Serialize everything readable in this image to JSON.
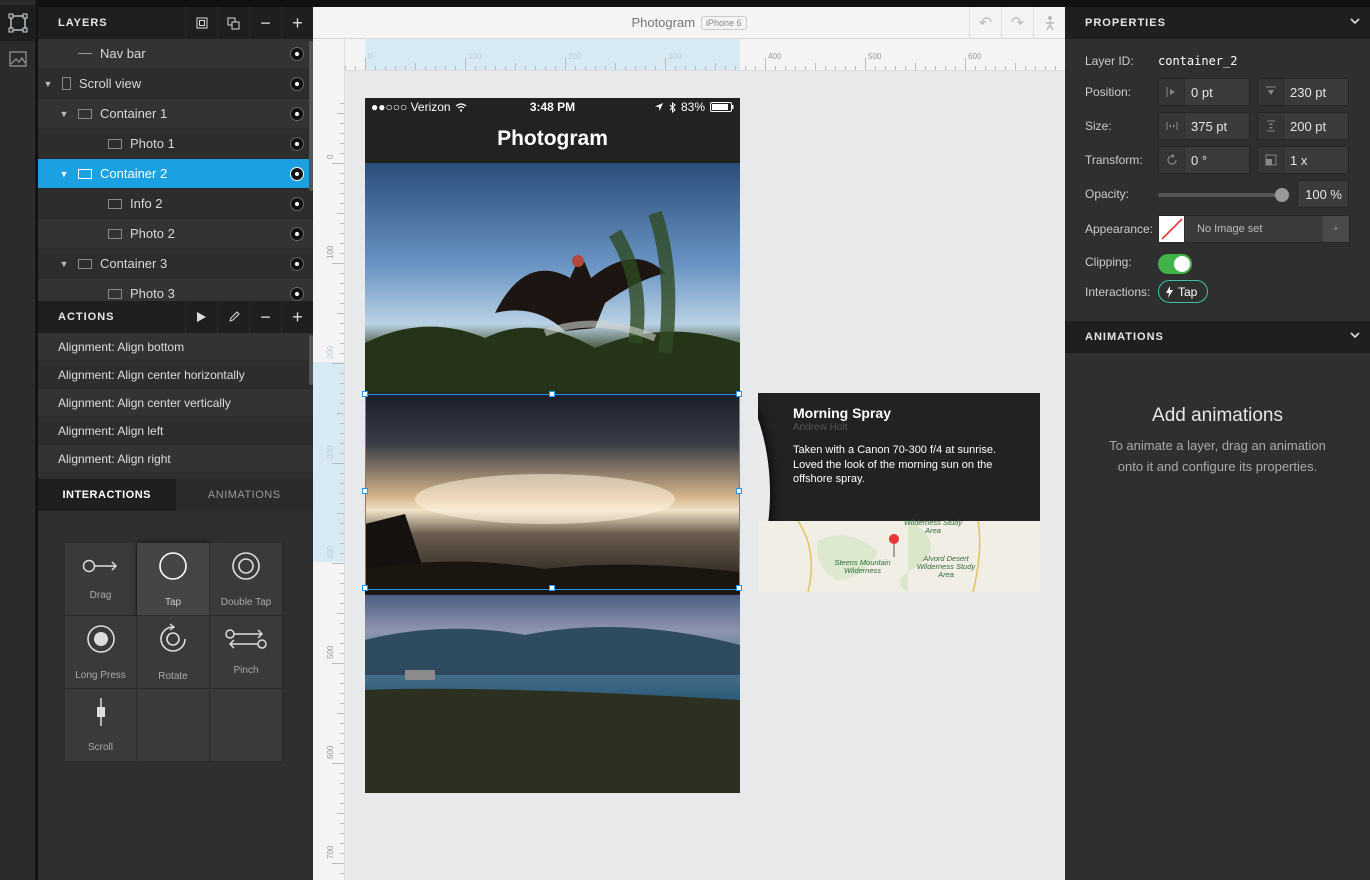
{
  "layers_panel": {
    "title": "LAYERS",
    "items": [
      {
        "label": "Nav bar",
        "indent": 1,
        "expander": "",
        "icon": "line"
      },
      {
        "label": "Scroll view",
        "indent": 0,
        "expander": "▼",
        "icon": "tall"
      },
      {
        "label": "Container 1",
        "indent": 1,
        "expander": "▼",
        "icon": "rect"
      },
      {
        "label": "Photo 1",
        "indent": 2,
        "expander": "",
        "icon": "rect"
      },
      {
        "label": "Container 2",
        "indent": 1,
        "expander": "▼",
        "icon": "rect",
        "selected": true
      },
      {
        "label": "Info 2",
        "indent": 2,
        "expander": "",
        "icon": "rect"
      },
      {
        "label": "Photo 2",
        "indent": 2,
        "expander": "",
        "icon": "rect"
      },
      {
        "label": "Container 3",
        "indent": 1,
        "expander": "▼",
        "icon": "rect"
      },
      {
        "label": "Photo 3",
        "indent": 2,
        "expander": "",
        "icon": "rect"
      }
    ]
  },
  "actions_panel": {
    "title": "ACTIONS",
    "items": [
      "Alignment: Align bottom",
      "Alignment: Align center horizontally",
      "Alignment: Align center vertically",
      "Alignment: Align left",
      "Alignment: Align right"
    ]
  },
  "bottom_tabs": {
    "interactions": "INTERACTIONS",
    "animations": "ANIMATIONS"
  },
  "gestures": [
    {
      "label": "Drag",
      "icon": "drag-icon"
    },
    {
      "label": "Tap",
      "icon": "tap-icon",
      "active": true
    },
    {
      "label": "Double Tap",
      "icon": "double-tap-icon"
    },
    {
      "label": "Long Press",
      "icon": "long-press-icon"
    },
    {
      "label": "Rotate",
      "icon": "rotate-icon"
    },
    {
      "label": "Pinch",
      "icon": "pinch-icon"
    },
    {
      "label": "Scroll",
      "icon": "scroll-icon"
    },
    {
      "label": "",
      "icon": ""
    },
    {
      "label": "",
      "icon": ""
    }
  ],
  "canvas": {
    "doc_title": "Photogram",
    "device": "iPhone 6",
    "ruler_h_labels": [
      "0",
      "100",
      "200",
      "300",
      "400",
      "500",
      "600"
    ],
    "ruler_v_labels": [
      "0",
      "100",
      "200",
      "300",
      "400",
      "500",
      "600",
      "700"
    ]
  },
  "phone": {
    "carrier": "●●○○○ Verizon",
    "time": "3:48 PM",
    "battery": "83%",
    "nav_title": "Photogram"
  },
  "info_card": {
    "title": "Morning Spray",
    "author": "Andrew Holt",
    "description": "Taken with a Canon 70-300 f/4 at sunrise. Loved the look of the morning sun on the offshore spray.",
    "map_labels": [
      "Wilderness Study Area",
      "Steens Mountain Wilderness",
      "Alvord Desert Wilderness Study Area"
    ]
  },
  "properties": {
    "title": "PROPERTIES",
    "layer_id_label": "Layer ID:",
    "layer_id": "container_2",
    "position_label": "Position:",
    "position_x": "0 pt",
    "position_y": "230 pt",
    "size_label": "Size:",
    "size_w": "375 pt",
    "size_h": "200 pt",
    "transform_label": "Transform:",
    "rotation": "0 °",
    "scale": "1 x",
    "opacity_label": "Opacity:",
    "opacity": "100 %",
    "opacity_level": 1.0,
    "appearance_label": "Appearance:",
    "appearance_value": "No Image set",
    "appearance_add": "+",
    "clipping_label": "Clipping:",
    "clipping_on": true,
    "interactions_label": "Interactions:",
    "interaction_chip": "Tap"
  },
  "animations": {
    "title": "ANIMATIONS",
    "empty_title": "Add animations",
    "empty_desc": "To animate a layer, drag an animation onto it and configure its properties."
  },
  "colors": {
    "selection": "#1ba1e2",
    "toggle_on": "#41b14a",
    "chip_border": "#39c4a7",
    "panel_bg": "#2f2f2f",
    "canvas_bg": "#e8e9ea"
  }
}
